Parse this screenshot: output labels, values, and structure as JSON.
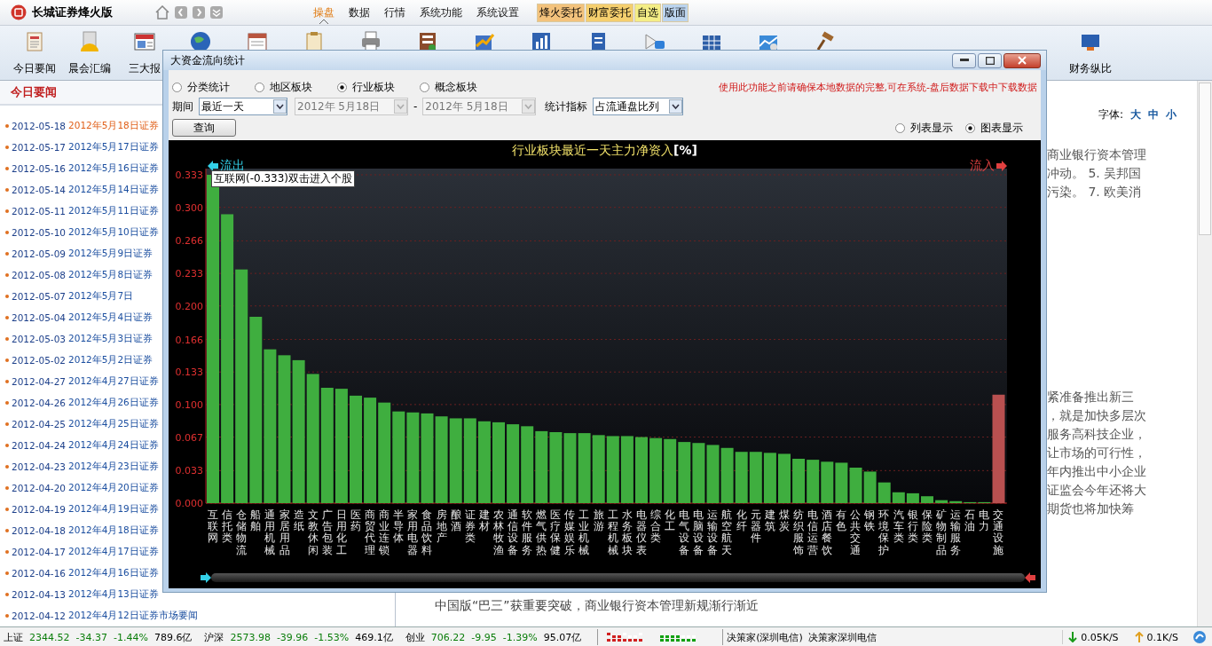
{
  "app": {
    "title": "长城证券烽火版"
  },
  "menu": [
    {
      "label": "操盘",
      "selected": true
    },
    {
      "label": "数据",
      "selected": false
    },
    {
      "label": "行情",
      "selected": false
    },
    {
      "label": "系统功能",
      "selected": false
    },
    {
      "label": "系统设置",
      "selected": false
    }
  ],
  "quick_buttons": [
    {
      "label": "烽火委托",
      "color": "#f3c27c"
    },
    {
      "label": "财富委托",
      "color": "#f5cf6e"
    },
    {
      "label": "自选",
      "color": "#f4ee86"
    },
    {
      "label": "版面",
      "color": "#bcd4ee"
    }
  ],
  "toolbar": {
    "items": [
      {
        "label": "今日要闻"
      },
      {
        "label": "晨会汇编"
      },
      {
        "label": "三大报"
      }
    ],
    "right_items": [
      {
        "label": "财务纵比"
      }
    ]
  },
  "news_panel": {
    "heading": "今日要闻",
    "items": [
      {
        "date": "2012-05-18",
        "title": "2012年5月18日证券",
        "selected": true
      },
      {
        "date": "2012-05-17",
        "title": "2012年5月17日证券",
        "selected": false
      },
      {
        "date": "2012-05-16",
        "title": "2012年5月16日证券",
        "selected": false
      },
      {
        "date": "2012-05-14",
        "title": "2012年5月14日证券",
        "selected": false
      },
      {
        "date": "2012-05-11",
        "title": "2012年5月11日证券",
        "selected": false
      },
      {
        "date": "2012-05-10",
        "title": "2012年5月10日证券",
        "selected": false
      },
      {
        "date": "2012-05-09",
        "title": "2012年5月9日证券",
        "selected": false
      },
      {
        "date": "2012-05-08",
        "title": "2012年5月8日证券",
        "selected": false
      },
      {
        "date": "2012-05-07",
        "title": "2012年5月7日",
        "selected": false
      },
      {
        "date": "2012-05-04",
        "title": "2012年5月4日证券",
        "selected": false
      },
      {
        "date": "2012-05-03",
        "title": "2012年5月3日证券",
        "selected": false
      },
      {
        "date": "2012-05-02",
        "title": "2012年5月2日证券",
        "selected": false
      },
      {
        "date": "2012-04-27",
        "title": "2012年4月27日证券",
        "selected": false
      },
      {
        "date": "2012-04-26",
        "title": "2012年4月26日证券",
        "selected": false
      },
      {
        "date": "2012-04-25",
        "title": "2012年4月25日证券",
        "selected": false
      },
      {
        "date": "2012-04-24",
        "title": "2012年4月24日证券",
        "selected": false
      },
      {
        "date": "2012-04-23",
        "title": "2012年4月23日证券",
        "selected": false
      },
      {
        "date": "2012-04-20",
        "title": "2012年4月20日证券",
        "selected": false
      },
      {
        "date": "2012-04-19",
        "title": "2012年4月19日证券",
        "selected": false
      },
      {
        "date": "2012-04-18",
        "title": "2012年4月18日证券",
        "selected": false
      },
      {
        "date": "2012-04-17",
        "title": "2012年4月17日证券",
        "selected": false
      },
      {
        "date": "2012-04-16",
        "title": "2012年4月16日证券",
        "selected": false
      },
      {
        "date": "2012-04-13",
        "title": "2012年4月13日证券",
        "selected": false
      },
      {
        "date": "2012-04-12",
        "title": "2012年4月12日证券市场要闻",
        "selected": false
      }
    ]
  },
  "article": {
    "font_label": "字体:",
    "font_sizes": [
      "大",
      "中",
      "小"
    ],
    "fragment_top": [
      "商业银行资本管理",
      "冲动。 5. 吴邦国",
      "污染。 7. 欧美消"
    ],
    "fragment_mid": [
      "紧准备推出新三",
      "，就是加快多层次",
      "服务高科技企业，",
      "让市场的可行性，",
      "年内推出中小企业",
      "证监会今年还将大",
      "期货也将加快筹"
    ],
    "headline": "中国版“巴三”获重要突破，商业银行资本管理新规渐行渐近"
  },
  "dialog": {
    "title": "大资金流向统计",
    "scope_options": [
      {
        "label": "分类统计",
        "selected": false
      },
      {
        "label": "地区板块",
        "selected": false
      },
      {
        "label": "行业板块",
        "selected": true
      },
      {
        "label": "概念板块",
        "selected": false
      }
    ],
    "notice": "使用此功能之前请确保本地数据的完整,可在系统-盘后数据下载中下载数据",
    "period_label": "期间",
    "period": "最近一天",
    "date_from": {
      "value": "2012年 5月18日",
      "disabled": true
    },
    "date_separator": "-",
    "date_to": {
      "value": "2012年 5月18日",
      "disabled": true
    },
    "metric_label": "统计指标",
    "metric": "占流通盘比列",
    "query_button": "查询",
    "view_options": [
      {
        "label": "列表显示",
        "selected": false
      },
      {
        "label": "图表显示",
        "selected": true
      }
    ],
    "chart": {
      "tooltip": "互联网(-0.333)双击进入个股",
      "chart_data": {
        "type": "bar",
        "title": "行业板块最近一天主力净资入**[%]**",
        "stacked": true,
        "grid": true,
        "categories": [
          "互联网",
          "信托类",
          "仓储物流",
          "船舶",
          "通用机械",
          "家居用品",
          "造纸",
          "文教休闲",
          "广告包装",
          "日用化工",
          "医药",
          "商贸代理",
          "商业连锁",
          "半导体",
          "家用电器",
          "食品饮料",
          "房地产",
          "酿酒",
          "证券类",
          "建材",
          "农林牧渔",
          "通信设备",
          "软件服务",
          "燃气供热",
          "医疗保健",
          "传媒娱乐",
          "工业机械",
          "旅游",
          "工程机械",
          "水务板块",
          "电器仪表",
          "综合类",
          "化工",
          "电气设备",
          "电脑设备",
          "运输设备",
          "航空航天",
          "化纤",
          "元器件",
          "建筑",
          "煤炭",
          "纺织服饰",
          "电信运营",
          "酒店餐饮",
          "有色",
          "公共交通",
          "钢铁",
          "环境保护",
          "汽车类",
          "银行类",
          "保险类",
          "矿物制品",
          "运输服务",
          "石油",
          "电力",
          "交通设施"
        ],
        "series": [
          {
            "name": "流出",
            "color": "#3fae3f",
            "values": [
              0.333,
              0.293,
              0.237,
              0.189,
              0.156,
              0.15,
              0.145,
              0.131,
              0.117,
              0.116,
              0.109,
              0.107,
              0.102,
              0.093,
              0.092,
              0.091,
              0.088,
              0.086,
              0.086,
              0.083,
              0.082,
              0.08,
              0.078,
              0.073,
              0.072,
              0.071,
              0.071,
              0.069,
              0.068,
              0.068,
              0.067,
              0.066,
              0.065,
              0.062,
              0.061,
              0.059,
              0.056,
              0.052,
              0.052,
              0.051,
              0.05,
              0.045,
              0.044,
              0.042,
              0.041,
              0.036,
              0.032,
              0.021,
              0.011,
              0.01,
              0.007,
              0.003,
              0.002,
              0.001,
              0.001,
              null
            ]
          },
          {
            "name": "流入",
            "color": "#b85050",
            "values": [
              null,
              null,
              null,
              null,
              null,
              null,
              null,
              null,
              null,
              null,
              null,
              null,
              null,
              null,
              null,
              null,
              null,
              null,
              null,
              null,
              null,
              null,
              null,
              null,
              null,
              null,
              null,
              null,
              null,
              null,
              null,
              null,
              null,
              null,
              null,
              null,
              null,
              null,
              null,
              null,
              null,
              null,
              null,
              null,
              null,
              null,
              null,
              null,
              null,
              null,
              null,
              null,
              null,
              null,
              null,
              0.11
            ]
          }
        ],
        "ylim": [
          0,
          0.333
        ],
        "yticks": [
          {
            "value": 0,
            "label": "0.000"
          },
          {
            "value": 0.033,
            "label": "0.033"
          },
          {
            "value": 0.067,
            "label": "0.067"
          },
          {
            "value": 0.1,
            "label": "0.100"
          },
          {
            "value": 0.133,
            "label": "0.133"
          },
          {
            "value": 0.166,
            "label": "0.166"
          },
          {
            "value": 0.2,
            "label": "0.200"
          },
          {
            "value": 0.233,
            "label": "0.233"
          },
          {
            "value": 0.266,
            "label": "0.266"
          },
          {
            "value": 0.3,
            "label": "0.300"
          },
          {
            "value": 0.333,
            "label": "0.333"
          }
        ]
      }
    }
  },
  "status_bar": {
    "indexes": [
      {
        "name": "上证",
        "value": "2344.52",
        "change": "-34.37",
        "percent": "-1.44%",
        "amount": "789.6亿"
      },
      {
        "name": "沪深",
        "value": "2573.98",
        "change": "-39.96",
        "percent": "-1.53%",
        "amount": "469.1亿"
      },
      {
        "name": "创业",
        "value": "706.22",
        "change": "-9.95",
        "percent": "-1.39%",
        "amount": "95.07亿"
      }
    ],
    "server": "决策家(深圳电信)",
    "server_name": "决策家深圳电信",
    "download": "0.05K/S",
    "upload": "0.1K/S"
  }
}
